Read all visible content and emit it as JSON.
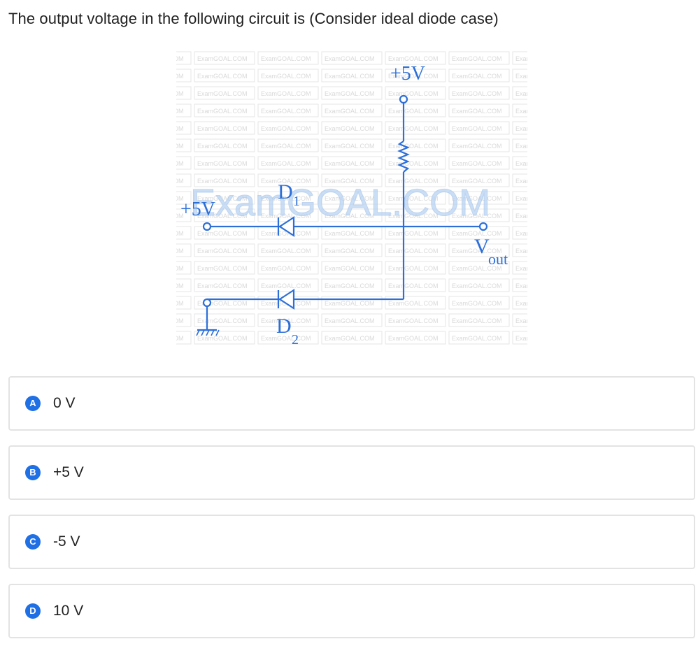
{
  "question": {
    "text": "The output voltage in the following circuit is (Consider ideal diode case)"
  },
  "figure": {
    "watermark_text": "ExamGOAL.COM",
    "watermark_small": "ExamGOAL.COM",
    "top_supply": "+5V",
    "left_supply": "+5V",
    "d1_letter": "D",
    "d1_sub": "1",
    "d2_letter": "D",
    "d2_sub": "2",
    "vout_letter": "V",
    "vout_sub": "out",
    "line_color": "#2c6fd8"
  },
  "options": [
    {
      "letter": "A",
      "text": "0 V"
    },
    {
      "letter": "B",
      "text": "+5 V"
    },
    {
      "letter": "C",
      "text": "-5 V"
    },
    {
      "letter": "D",
      "text": "10 V"
    }
  ]
}
